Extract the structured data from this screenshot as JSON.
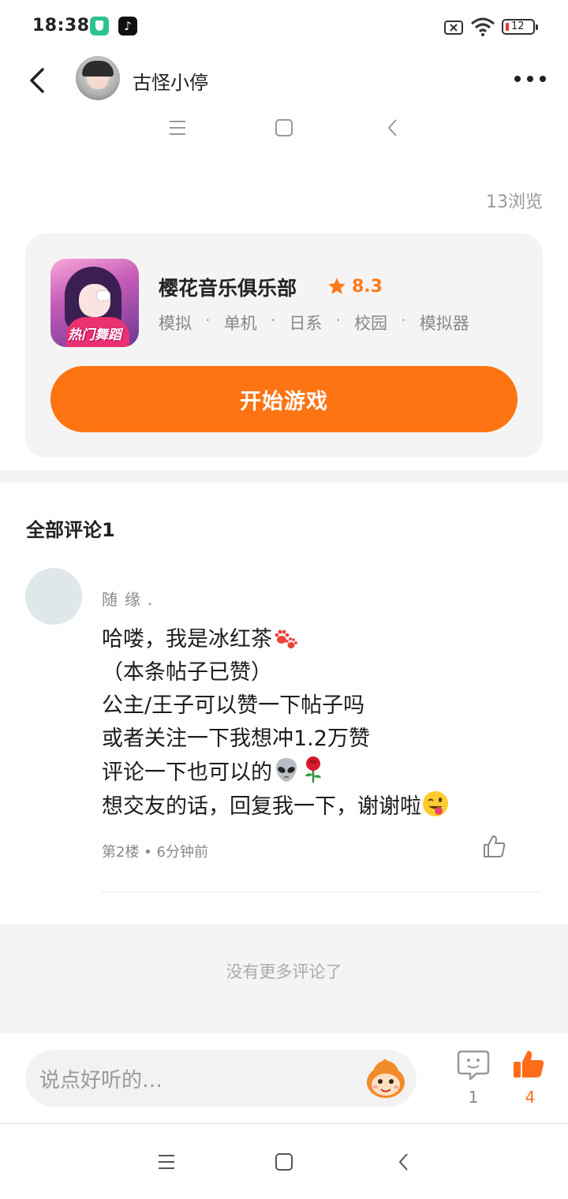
{
  "status_bar": {
    "time": "18:38",
    "battery_level": "12",
    "app_icons": [
      "shield-app-icon",
      "tiktok-icon"
    ]
  },
  "header": {
    "back_icon": "chevron-left-icon",
    "user_name": "古怪小停",
    "more_icon": "more-dots-icon"
  },
  "mini_nav": [
    "menu-icon",
    "home-square-icon",
    "back-chevron-icon"
  ],
  "view_count": "13浏览",
  "game": {
    "title": "樱花音乐俱乐部",
    "rating": "8.3",
    "icon_label": "热门舞蹈",
    "tags": [
      "模拟",
      "单机",
      "日系",
      "校园",
      "模拟器"
    ],
    "tag_separator": "·",
    "start_label": "开始游戏",
    "accent_color": "#ff7412"
  },
  "comments": {
    "title": "全部评论1",
    "items": [
      {
        "user": "随缘.",
        "lines": [
          {
            "text": "哈喽，我是冰红茶",
            "emoji": "paw-prints-emoji"
          },
          {
            "text": "（本条帖子已赞）"
          },
          {
            "text": "公主/王子可以赞一下帖子吗"
          },
          {
            "text": "或者关注一下我想冲1.2万赞"
          },
          {
            "text": "评论一下也可以的",
            "emoji": "alien-and-rose-emoji"
          },
          {
            "text": "想交友的话，回复我一下，谢谢啦",
            "emoji": "winking-tongue-emoji"
          }
        ],
        "meta": "第2楼 • 6分钟前"
      }
    ],
    "no_more": "没有更多评论了"
  },
  "input_bar": {
    "placeholder": "说点好听的…",
    "comment_count": "1",
    "like_count": "4",
    "like_color": "#ff6d1a"
  },
  "system_nav": [
    "menu-icon",
    "home-square-icon",
    "back-chevron-icon"
  ]
}
